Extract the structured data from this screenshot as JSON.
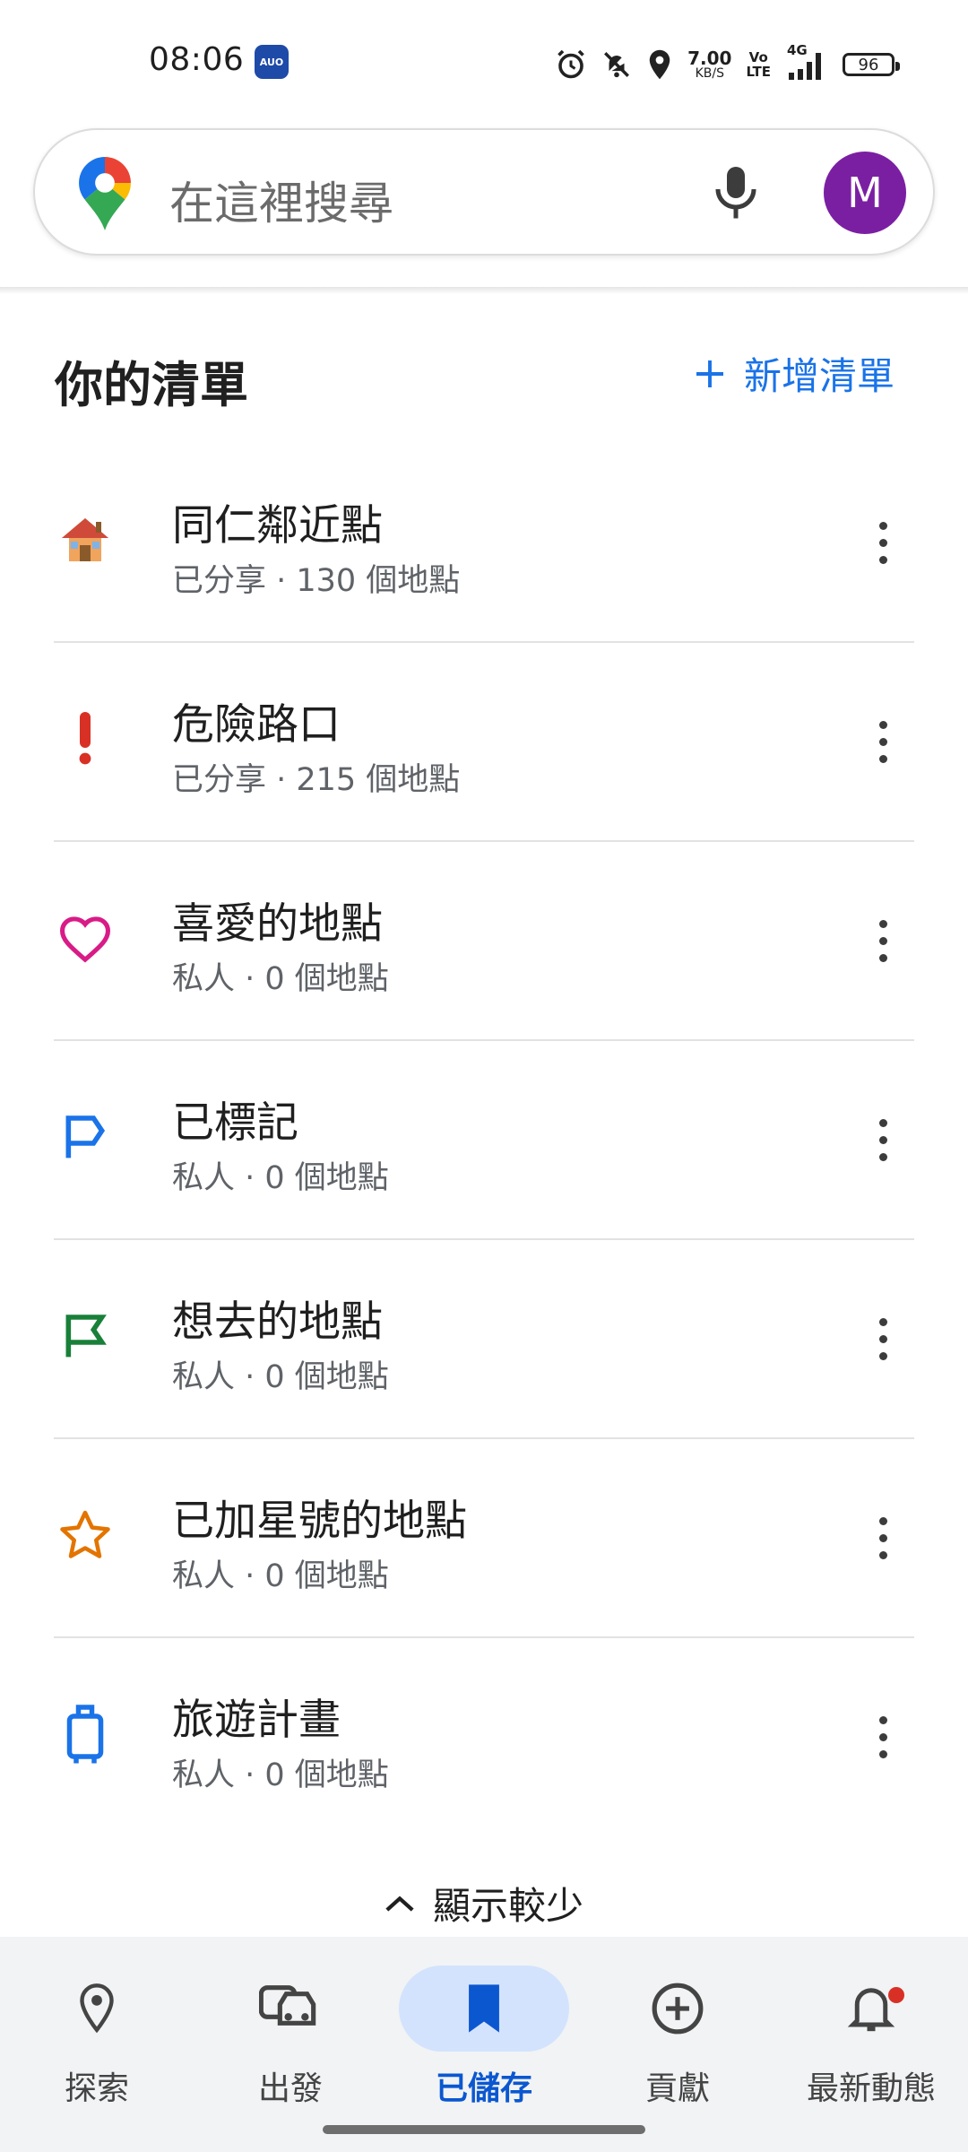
{
  "status_bar": {
    "time": "08:06",
    "app_icon_text": "AUO",
    "net_speed_value": "7.00",
    "net_speed_unit": "KB/S",
    "volte_top": "Vo",
    "volte_bottom": "LTE",
    "network": "4G",
    "battery": "96"
  },
  "search": {
    "placeholder": "在這裡搜尋",
    "avatar_letter": "M",
    "avatar_color": "#7b1fa2"
  },
  "section": {
    "title": "你的清單",
    "new_list_label": "新增清單"
  },
  "lists": [
    {
      "title": "同仁鄰近點",
      "subtitle": "已分享 · 130 個地點",
      "icon": "house-icon"
    },
    {
      "title": "危險路口",
      "subtitle": "已分享 · 215 個地點",
      "icon": "exclamation-icon"
    },
    {
      "title": "喜愛的地點",
      "subtitle": "私人 · 0 個地點",
      "icon": "heart-icon"
    },
    {
      "title": "已標記",
      "subtitle": "私人 · 0 個地點",
      "icon": "flag-outline-icon"
    },
    {
      "title": "想去的地點",
      "subtitle": "私人 · 0 個地點",
      "icon": "flag-green-icon"
    },
    {
      "title": "已加星號的地點",
      "subtitle": "私人 · 0 個地點",
      "icon": "star-icon"
    },
    {
      "title": "旅遊計畫",
      "subtitle": "私人 · 0 個地點",
      "icon": "suitcase-icon"
    }
  ],
  "show_less_label": "顯示較少",
  "nav": {
    "items": [
      {
        "label": "探索",
        "icon": "location-pin-icon"
      },
      {
        "label": "出發",
        "icon": "car-icon"
      },
      {
        "label": "已儲存",
        "icon": "bookmark-icon",
        "active": true
      },
      {
        "label": "貢獻",
        "icon": "add-circle-icon"
      },
      {
        "label": "最新動態",
        "icon": "bell-icon"
      }
    ]
  },
  "colors": {
    "accent": "#1a73e8",
    "active_nav": "#0b57d0",
    "active_nav_bg": "#d3e3fd",
    "heart": "#d81b87",
    "exclamation": "#d93025",
    "flag_green": "#188038",
    "star": "#e37400"
  }
}
